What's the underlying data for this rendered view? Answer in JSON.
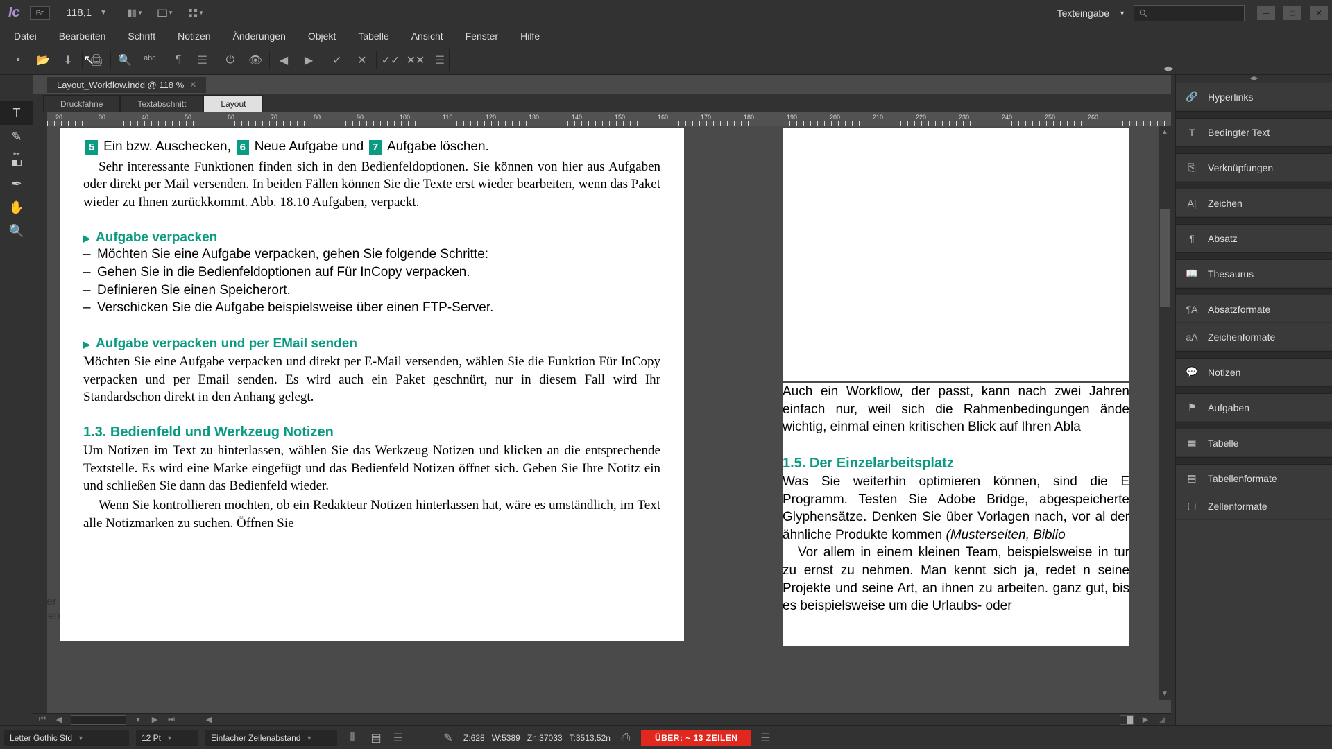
{
  "titlebar": {
    "br_label": "Br",
    "zoom_value": "118,1",
    "workspace": "Texteingabe"
  },
  "menubar": [
    "Datei",
    "Bearbeiten",
    "Schrift",
    "Notizen",
    "Änderungen",
    "Objekt",
    "Tabelle",
    "Ansicht",
    "Fenster",
    "Hilfe"
  ],
  "doc_tab": {
    "title": "Layout_Workflow.indd @ 118 %"
  },
  "subtabs": {
    "galley": "Druckfahne",
    "story": "Textabschnitt",
    "layout": "Layout"
  },
  "ruler_marks": [
    "20",
    "30",
    "40",
    "50",
    "60",
    "70",
    "80",
    "90",
    "100",
    "110",
    "120",
    "130",
    "140",
    "150",
    "160",
    "170",
    "180",
    "190",
    "200",
    "210",
    "220",
    "230",
    "240",
    "250",
    "260"
  ],
  "page": {
    "line1_a": "Ein bzw. Auschecken,",
    "line1_b": "Neue Aufgabe und",
    "line1_c": "Aufgabe löschen.",
    "badge5": "5",
    "badge6": "6",
    "badge7": "7",
    "para1": "Sehr interessante Funktionen finden sich in den Bedienfeldoptionen. Sie können von hier aus Aufgaben oder direkt per Mail versenden. In beiden Fällen können Sie die Texte erst wieder bearbeiten, wenn das Paket wieder zu Ihnen zurückkommt. Abb. 18.10 Aufgaben, verpackt.",
    "h1": "Aufgabe verpacken",
    "b1": "Möchten Sie eine Aufgabe verpacken, gehen Sie folgende Schritte:",
    "b2": "Gehen Sie in die Bedienfeldoptionen auf Für InCopy verpacken.",
    "b3": "Definieren Sie einen Speicherort.",
    "b4": "Verschicken Sie die Aufgabe beispielsweise über einen FTP-Server.",
    "h2": "Aufgabe verpacken und per EMail senden",
    "para2": "Möchten Sie eine Aufgabe verpacken und direkt per E-Mail versenden, wählen Sie die Funktion Für InCopy verpacken und per Email senden. Es wird auch ein Paket geschnürt, nur in diesem Fall wird Ihr Standardschon direkt in den Anhang gelegt.",
    "h3": "1.3.   Bedienfeld und Werkzeug Notizen",
    "para3": "Um Notizen im Text zu hinterlassen, wählen Sie das Werkzeug Notizen und klicken an die entsprechende Textstelle. Es wird eine Marke eingefügt und das Bedienfeld Notizen öffnet sich. Geben Sie Ihre Notitz ein und schließen Sie dann das Bedienfeld wieder.",
    "para4": "Wenn Sie kontrollieren möchten, ob ein Redakteur Notizen hinterlassen hat, wäre es umständlich, im Text alle Notizmarken zu suchen. Öffnen Sie",
    "marginal": "ller\nden"
  },
  "page2": {
    "intro": "Auch ein Workflow, der passt, kann nach zwei Jahren einfach nur, weil sich die Rahmenbedingungen ände wichtig, einmal einen kritischen Blick auf Ihren Abla",
    "h": "1.5.   Der Einzelarbeitsplatz",
    "p1": "Was Sie weiterhin optimieren können, sind die E Programm. Testen Sie Adobe Bridge, abgespeicherte Glyphensätze. Denken Sie über Vorlagen nach, vor al der ähnliche Produkte kommen ",
    "p1_ital": "(Musterseiten, Biblio",
    "p2": "Vor allem in einem kleinen Team, beispielsweise in tur zu ernst zu nehmen. Man kennt sich ja, redet n seine Projekte und seine Art, an ihnen zu arbeiten. ganz gut, bis es beispielsweise um die Urlaubs- oder"
  },
  "panels": [
    {
      "icon": "🔗",
      "label": "Hyperlinks"
    },
    {
      "sep": true
    },
    {
      "icon": "T",
      "label": "Bedingter Text"
    },
    {
      "sep": true
    },
    {
      "icon": "⎘",
      "label": "Verknüpfungen"
    },
    {
      "sep": true
    },
    {
      "icon": "A|",
      "label": "Zeichen"
    },
    {
      "sep": true
    },
    {
      "icon": "¶",
      "label": "Absatz"
    },
    {
      "sep": true
    },
    {
      "icon": "📖",
      "label": "Thesaurus"
    },
    {
      "sep": true
    },
    {
      "icon": "¶A",
      "label": "Absatzformate"
    },
    {
      "icon": "aA",
      "label": "Zeichenformate"
    },
    {
      "sep": true
    },
    {
      "icon": "💬",
      "label": "Notizen"
    },
    {
      "sep": true
    },
    {
      "icon": "⚑",
      "label": "Aufgaben"
    },
    {
      "sep": true
    },
    {
      "icon": "▦",
      "label": "Tabelle"
    },
    {
      "sep": true
    },
    {
      "icon": "▤",
      "label": "Tabellenformate"
    },
    {
      "icon": "▢",
      "label": "Zellenformate"
    }
  ],
  "status": {
    "font": "Letter Gothic Std",
    "size": "12 Pt",
    "leading": "Einfacher Zeilenabstand",
    "z": "Z:628",
    "w": "W:5389",
    "zn": "Zn:37033",
    "t": "T:3513,52n",
    "alert": "ÜBER:  ~ 13 ZEILEN"
  }
}
